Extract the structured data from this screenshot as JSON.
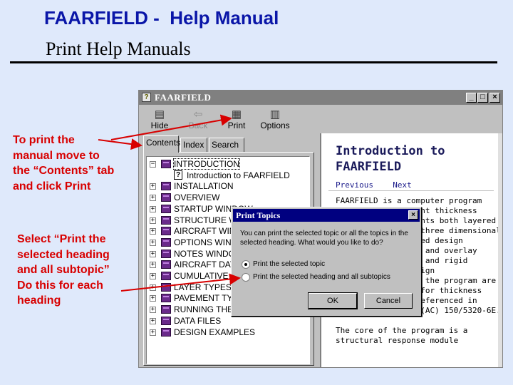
{
  "slide": {
    "title": "FAARFIELD -  Help Manual",
    "subtitle": "Print Help Manuals"
  },
  "notes": {
    "note1": [
      "To print the",
      "manual move to",
      "the “Contents” tab",
      "and click Print"
    ],
    "note2": [
      "Select “Print the",
      "selected heading",
      "and all subtopic”",
      "Do this for each",
      "heading"
    ]
  },
  "window": {
    "title": "FAARFIELD",
    "controls": {
      "minimize": "_",
      "maximize": "□",
      "close": "×"
    },
    "toolbar": [
      {
        "label": "Hide",
        "icon": "hide-icon"
      },
      {
        "label": "Back",
        "icon": "back-icon"
      },
      {
        "label": "Print",
        "icon": "print-icon"
      },
      {
        "label": "Options",
        "icon": "options-icon"
      }
    ],
    "tabs": [
      "Contents",
      "Index",
      "Search"
    ],
    "tree": [
      {
        "label": "INTRODUCTION",
        "type": "book",
        "expanded": true
      },
      {
        "label": "Introduction to FAARFIELD",
        "type": "topic"
      },
      {
        "label": "INSTALLATION",
        "type": "book"
      },
      {
        "label": "OVERVIEW",
        "type": "book"
      },
      {
        "label": "STARTUP WINDOW",
        "type": "book"
      },
      {
        "label": "STRUCTURE WINDOW",
        "type": "book"
      },
      {
        "label": "AIRCRAFT WINDOW",
        "type": "book"
      },
      {
        "label": "OPTIONS WINDOW",
        "type": "book"
      },
      {
        "label": "NOTES WINDOW",
        "type": "book"
      },
      {
        "label": "AIRCRAFT DATA",
        "type": "book"
      },
      {
        "label": "CUMULATIVE DAMAGE",
        "type": "book"
      },
      {
        "label": "LAYER TYPES",
        "type": "book"
      },
      {
        "label": "PAVEMENT TYPES",
        "type": "book"
      },
      {
        "label": "RUNNING THE PROGRAM",
        "type": "book"
      },
      {
        "label": "DATA FILES",
        "type": "book"
      },
      {
        "label": "DESIGN EXAMPLES",
        "type": "book"
      }
    ],
    "topic": {
      "title": "Introduction to\nFAARFIELD",
      "previous": "Previous",
      "next": "Next",
      "body": "FAARFIELD is a computer program\nfor airport pavement thickness\ndesign. It implements both layered\nelastic based and three dimensional\nfinite element based design\nprocedures for new and overlay\ndesign of flexible and rigid\npavements. The design\nprocedures used in the program are\nthe FAA standards for thickness\ndesign standards referenced in\nAdvisory Circular (AC) 150/5320-6E.\n\nThe core of the program is a\nstructural response module"
    }
  },
  "dialog": {
    "title": "Print Topics",
    "close": "×",
    "question": "You can print the selected topic or all the topics in the\nselected heading. What would you like to do?",
    "options": [
      "Print the selected topic",
      "Print the selected heading and all subtopics"
    ],
    "selected": 0,
    "ok": "OK",
    "cancel": "Cancel"
  },
  "colors": {
    "title": "#0a16a8",
    "note": "#d80000",
    "background": "#dfe9fb"
  }
}
